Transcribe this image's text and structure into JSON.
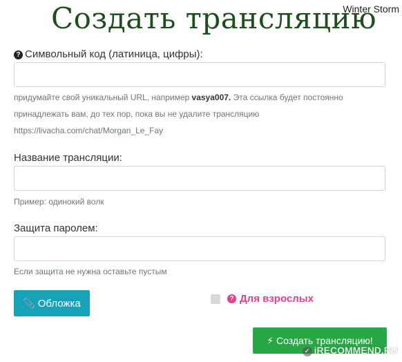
{
  "header": {
    "title": "Создать трансляцию",
    "username": "Winter Storm"
  },
  "form": {
    "code_field": {
      "label": "Символьный код (латиница, цифры):",
      "value": "",
      "help_before": "придумайте свой уникальный URL, например ",
      "help_example": "vasya007.",
      "help_after": " Эта ссылка будет постоянно принадлежать вам, до тех пор, пока вы не удалите трансляцию",
      "url_preview": "https://livacha.com/chat/Morgan_Le_Fay"
    },
    "name_field": {
      "label": "Название трансляции:",
      "value": "",
      "help": "Пример: одинокий волк"
    },
    "password_field": {
      "label": "Защита паролем:",
      "value": "",
      "help": "Если защита не нужна оставьте пустым"
    },
    "cover_button": {
      "label": "Обложка",
      "icon": "paperclip-icon"
    },
    "adult_checkbox": {
      "label": "Для взрослых",
      "checked": false,
      "icon": "question-circle-icon"
    },
    "submit_button": {
      "label": "Создать трансляцию!",
      "icon": "bolt-icon"
    }
  },
  "watermark": {
    "text": "iRECOMMEND.RU",
    "badge": "✓"
  },
  "colors": {
    "title": "#1f4d1f",
    "cover_button": "#17a2b8",
    "submit_button": "#28a745",
    "adult_label": "#e83e8c"
  }
}
